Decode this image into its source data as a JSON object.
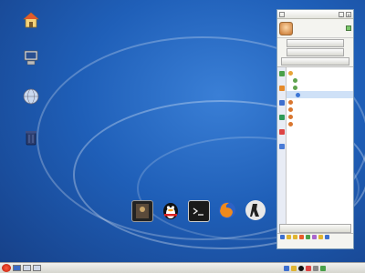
{
  "desktop": {
    "icons": [
      {
        "name": "home-folder",
        "label": ""
      },
      {
        "name": "computer",
        "label": ""
      },
      {
        "name": "network",
        "label": ""
      },
      {
        "name": "trash",
        "label": ""
      }
    ]
  },
  "qq": {
    "title": "",
    "user_name": "",
    "button_1": "",
    "button_2": "",
    "button_3": "",
    "main_button": "",
    "contacts": [
      {
        "label": ""
      },
      {
        "label": ""
      },
      {
        "label": ""
      },
      {
        "label": ""
      },
      {
        "label": ""
      },
      {
        "label": ""
      },
      {
        "label": ""
      },
      {
        "label": ""
      }
    ]
  },
  "dock": {
    "items": [
      {
        "name": "launcher",
        "label": ""
      },
      {
        "name": "qq",
        "label": ""
      },
      {
        "name": "terminal",
        "label": ""
      },
      {
        "name": "firefox",
        "label": ""
      },
      {
        "name": "counter-strike",
        "label": ""
      }
    ]
  },
  "taskbar": {
    "clock": ""
  },
  "colors": {
    "desktop_bg": "#1f5fb8",
    "selection": "#2b5dcc",
    "qq_frame": "#7f9db9"
  }
}
